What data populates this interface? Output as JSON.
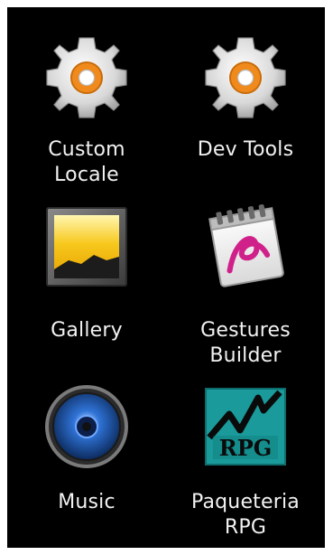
{
  "apps": [
    {
      "label": "Custom\nLocale",
      "icon": "gear-icon"
    },
    {
      "label": "Dev Tools",
      "icon": "gear-icon"
    },
    {
      "label": "Gallery",
      "icon": "gallery-icon"
    },
    {
      "label": "Gestures\nBuilder",
      "icon": "gestures-builder-icon"
    },
    {
      "label": "Music",
      "icon": "music-speaker-icon"
    },
    {
      "label": "Paqueteria\nRPG",
      "icon": "rpg-icon",
      "icon_text": "RPG"
    }
  ],
  "colors": {
    "background": "#000000",
    "frame": "#ffffff",
    "label": "#f2f2f2",
    "gear_orange": "#f08a1c",
    "rpg_teal": "#1a9a9a"
  }
}
